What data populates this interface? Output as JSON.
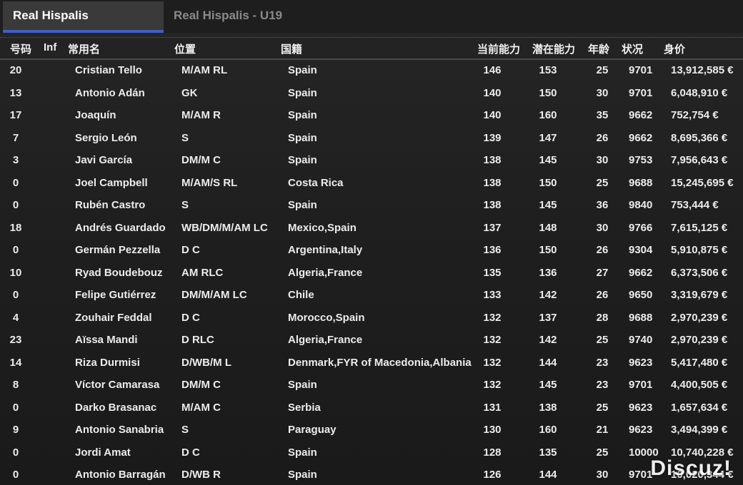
{
  "tabs": [
    {
      "label": "Real Hispalis",
      "active": true
    },
    {
      "label": "Real Hispalis - U19",
      "active": false
    }
  ],
  "header": {
    "number": "号码",
    "inf": "Inf",
    "name": "常用名",
    "position": "位置",
    "nationality": "国籍",
    "current_ability": "当前能力",
    "potential_ability": "潜在能力",
    "age": "年龄",
    "condition": "状况",
    "value": "身价"
  },
  "players": [
    {
      "number": "20",
      "name": "Cristian Tello",
      "position": "M/AM RL",
      "nationality": "Spain",
      "ca": "146",
      "pa": "153",
      "age": "25",
      "condition": "9701",
      "value": "13,912,585 €"
    },
    {
      "number": "13",
      "name": "Antonio Adán",
      "position": "GK",
      "nationality": "Spain",
      "ca": "140",
      "pa": "150",
      "age": "30",
      "condition": "9701",
      "value": "6,048,910 €"
    },
    {
      "number": "17",
      "name": "Joaquín",
      "position": "M/AM R",
      "nationality": "Spain",
      "ca": "140",
      "pa": "160",
      "age": "35",
      "condition": "9662",
      "value": "752,754 €"
    },
    {
      "number": "7",
      "name": "Sergio León",
      "position": "S",
      "nationality": "Spain",
      "ca": "139",
      "pa": "147",
      "age": "26",
      "condition": "9662",
      "value": "8,695,366 €"
    },
    {
      "number": "3",
      "name": "Javi García",
      "position": "DM/M C",
      "nationality": "Spain",
      "ca": "138",
      "pa": "145",
      "age": "30",
      "condition": "9753",
      "value": "7,956,643 €"
    },
    {
      "number": "0",
      "name": "Joel Campbell",
      "position": "M/AM/S RL",
      "nationality": "Costa Rica",
      "ca": "138",
      "pa": "150",
      "age": "25",
      "condition": "9688",
      "value": "15,245,695 €"
    },
    {
      "number": "0",
      "name": "Rubén Castro",
      "position": "S",
      "nationality": "Spain",
      "ca": "138",
      "pa": "145",
      "age": "36",
      "condition": "9840",
      "value": "753,444 €"
    },
    {
      "number": "18",
      "name": "Andrés Guardado",
      "position": "WB/DM/M/AM LC",
      "nationality": "Mexico,Spain",
      "ca": "137",
      "pa": "148",
      "age": "30",
      "condition": "9766",
      "value": "7,615,125 €"
    },
    {
      "number": "0",
      "name": "Germán Pezzella",
      "position": "D C",
      "nationality": "Argentina,Italy",
      "ca": "136",
      "pa": "150",
      "age": "26",
      "condition": "9304",
      "value": "5,910,875 €"
    },
    {
      "number": "10",
      "name": "Ryad Boudebouz",
      "position": "AM RLC",
      "nationality": "Algeria,France",
      "ca": "135",
      "pa": "136",
      "age": "27",
      "condition": "9662",
      "value": "6,373,506 €"
    },
    {
      "number": "0",
      "name": "Felipe Gutiérrez",
      "position": "DM/M/AM LC",
      "nationality": "Chile",
      "ca": "133",
      "pa": "142",
      "age": "26",
      "condition": "9650",
      "value": "3,319,679 €"
    },
    {
      "number": "4",
      "name": "Zouhair Feddal",
      "position": "D C",
      "nationality": "Morocco,Spain",
      "ca": "132",
      "pa": "137",
      "age": "28",
      "condition": "9688",
      "value": "2,970,239 €"
    },
    {
      "number": "23",
      "name": "Aïssa Mandi",
      "position": "D RLC",
      "nationality": "Algeria,France",
      "ca": "132",
      "pa": "142",
      "age": "25",
      "condition": "9740",
      "value": "2,970,239 €"
    },
    {
      "number": "14",
      "name": "Riza Durmisi",
      "position": "D/WB/M L",
      "nationality": "Denmark,FYR of Macedonia,Albania",
      "ca": "132",
      "pa": "144",
      "age": "23",
      "condition": "9623",
      "value": "5,417,480 €"
    },
    {
      "number": "8",
      "name": "Víctor Camarasa",
      "position": "DM/M C",
      "nationality": "Spain",
      "ca": "132",
      "pa": "145",
      "age": "23",
      "condition": "9701",
      "value": "4,400,505 €"
    },
    {
      "number": "0",
      "name": "Darko Brasanac",
      "position": "M/AM C",
      "nationality": "Serbia",
      "ca": "131",
      "pa": "138",
      "age": "25",
      "condition": "9623",
      "value": "1,657,634 €"
    },
    {
      "number": "9",
      "name": "Antonio Sanabria",
      "position": "S",
      "nationality": "Paraguay",
      "ca": "130",
      "pa": "160",
      "age": "21",
      "condition": "9623",
      "value": "3,494,399 €"
    },
    {
      "number": "0",
      "name": "Jordi Amat",
      "position": "D C",
      "nationality": "Spain",
      "ca": "128",
      "pa": "135",
      "age": "25",
      "condition": "10000",
      "value": "10,740,228 €"
    },
    {
      "number": "0",
      "name": "Antonio Barragán",
      "position": "D/WB R",
      "nationality": "Spain",
      "ca": "126",
      "pa": "144",
      "age": "30",
      "condition": "9701",
      "value": "10,020,344 €"
    }
  ],
  "watermark": "Discuz!"
}
